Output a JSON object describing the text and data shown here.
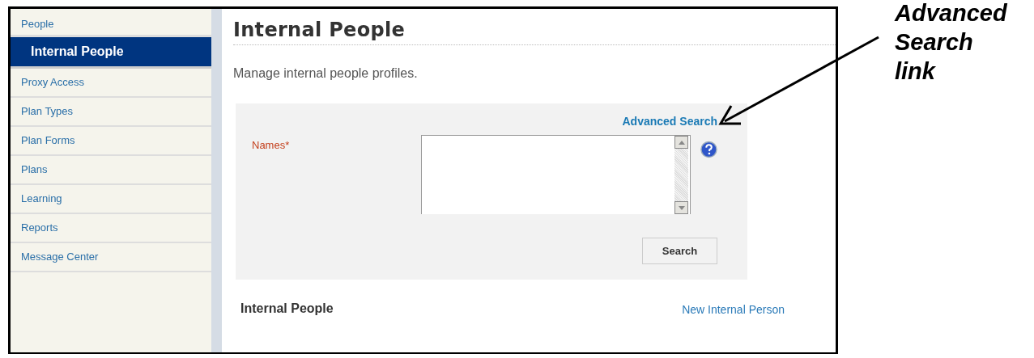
{
  "sidebar": {
    "items": [
      {
        "label": "People",
        "kind": "header",
        "selected": false
      },
      {
        "label": "Internal People",
        "kind": "item",
        "selected": true
      },
      {
        "label": "Proxy Access",
        "kind": "item",
        "selected": false
      },
      {
        "label": "Plan Types",
        "kind": "item",
        "selected": false
      },
      {
        "label": "Plan Forms",
        "kind": "item",
        "selected": false
      },
      {
        "label": "Plans",
        "kind": "item",
        "selected": false
      },
      {
        "label": "Learning",
        "kind": "item",
        "selected": false
      },
      {
        "label": "Reports",
        "kind": "item",
        "selected": false
      },
      {
        "label": "Message Center",
        "kind": "item",
        "selected": false
      }
    ]
  },
  "page": {
    "title": "Internal People",
    "description": "Manage internal people profiles."
  },
  "search_panel": {
    "advanced_link": "Advanced Search",
    "field_label": "Names*",
    "search_button": "Search"
  },
  "results": {
    "heading": "Internal People",
    "new_link": "New Internal Person"
  },
  "callout": {
    "text": "Advanced Search link"
  }
}
